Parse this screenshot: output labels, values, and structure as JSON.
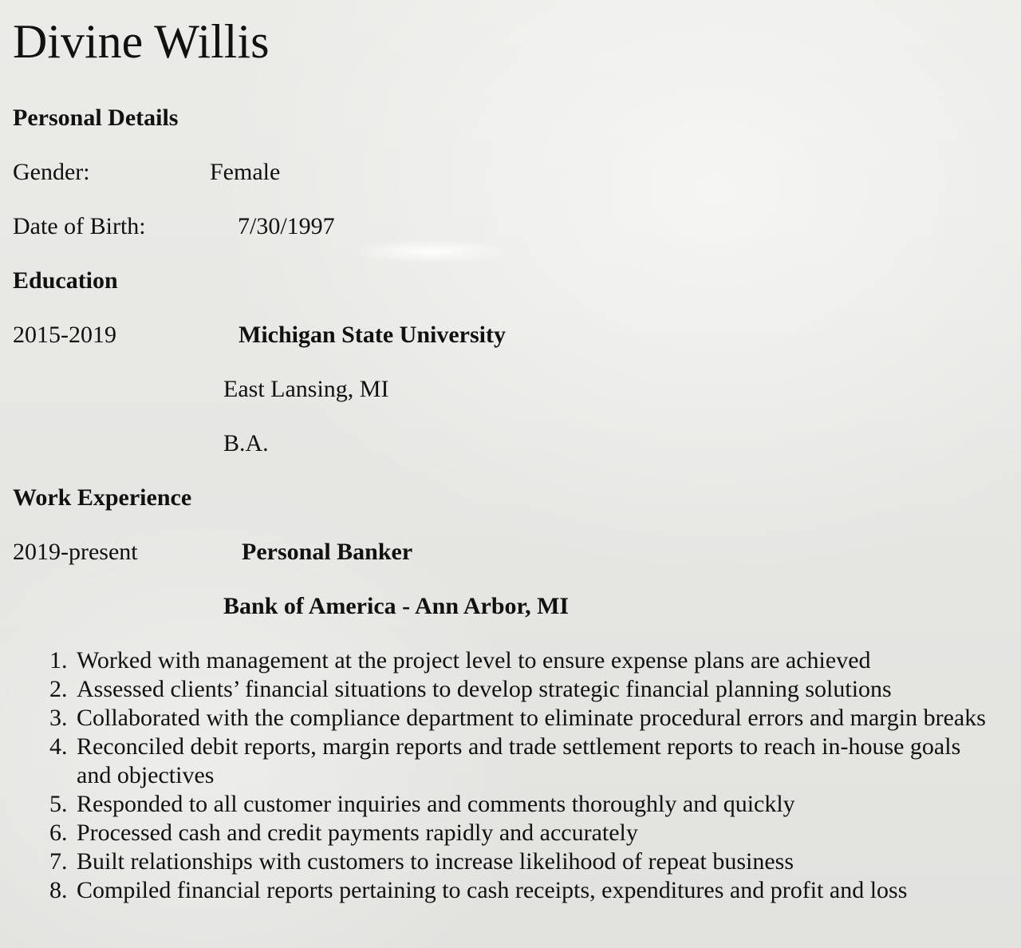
{
  "name": "Divine Willis",
  "personal": {
    "heading": "Personal Details",
    "gender_label": "Gender:",
    "gender_value": "Female",
    "dob_label": "Date of Birth:",
    "dob_value": "7/30/1997"
  },
  "education": {
    "heading": "Education",
    "years": "2015-2019",
    "school": "Michigan State University",
    "location": "East Lansing, MI",
    "degree": "B.A."
  },
  "work": {
    "heading": "Work Experience",
    "years": "2019-present",
    "title": "Personal Banker",
    "employer": "Bank of America - Ann Arbor, MI",
    "duties": [
      "Worked with management at the project level to ensure expense plans are achieved",
      "Assessed clients’ financial situations to develop strategic financial planning solutions",
      "Collaborated with the compliance department to eliminate procedural errors and margin breaks",
      "Reconciled debit reports, margin reports and trade settlement reports to reach in-house goals and objectives",
      "Responded to all customer inquiries and comments thoroughly and quickly",
      "Processed cash and credit payments rapidly and accurately",
      "Built relationships with customers to increase likelihood of repeat business",
      "Compiled financial reports pertaining to cash receipts, expenditures and profit and loss"
    ]
  }
}
